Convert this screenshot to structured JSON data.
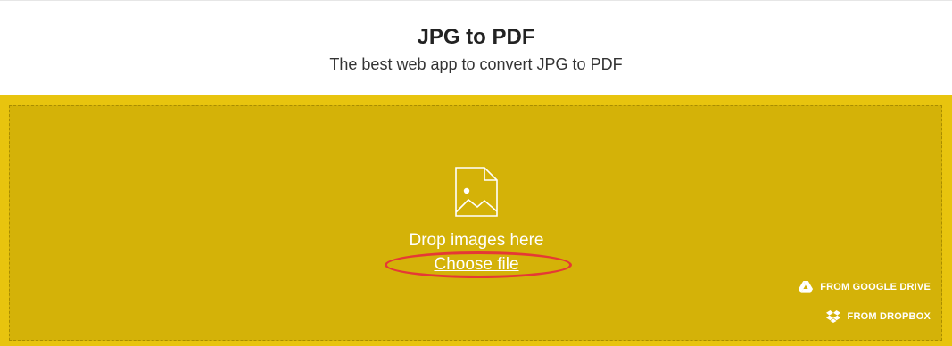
{
  "header": {
    "title": "JPG to PDF",
    "subtitle": "The best web app to convert JPG to PDF"
  },
  "dropzone": {
    "icon": "image-file-icon",
    "drop_text": "Drop images here",
    "choose_file_label": "Choose file",
    "sources": [
      {
        "label": "FROM GOOGLE DRIVE",
        "icon": "google-drive-icon"
      },
      {
        "label": "FROM DROPBOX",
        "icon": "dropbox-icon"
      }
    ]
  },
  "annotation": {
    "highlight_color": "#e53935"
  },
  "colors": {
    "outer_yellow": "#e8c40e",
    "dropzone_yellow": "#d4b208"
  }
}
